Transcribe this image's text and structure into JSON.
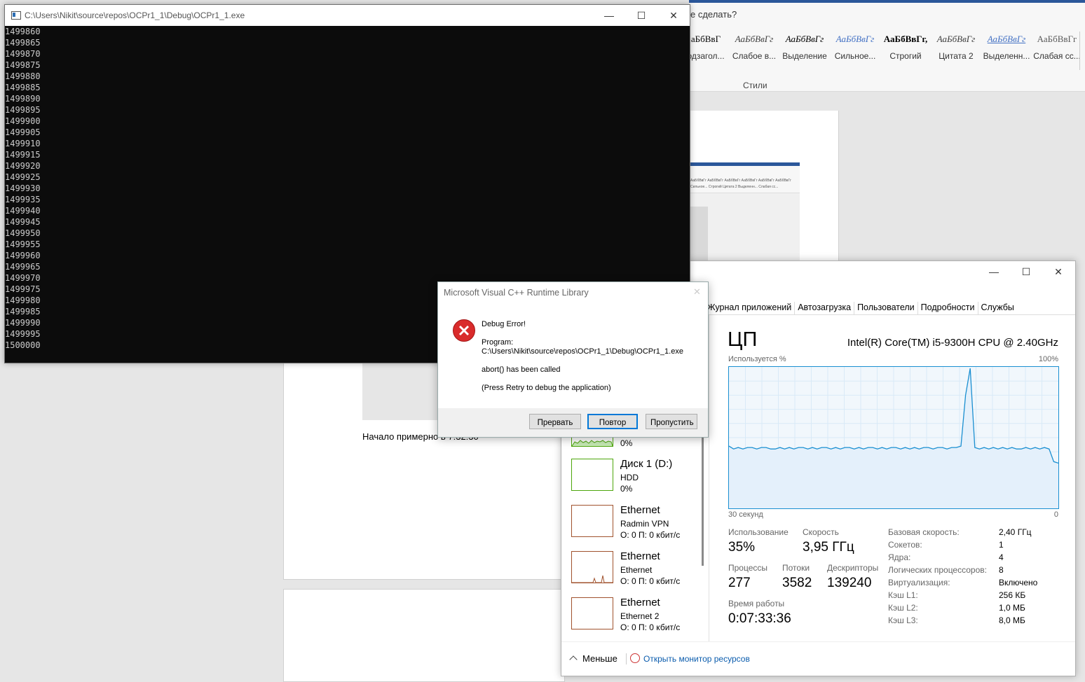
{
  "word": {
    "tell_me": "е сделать?",
    "styles": [
      {
        "sample": "аБбВвГ",
        "name": "одзагол..."
      },
      {
        "sample": "АаБбВвГг",
        "name": "Слабое в..."
      },
      {
        "sample": "АаБбВвГг",
        "name": "Выделение"
      },
      {
        "sample": "АаБбВвГг",
        "name": "Сильное..."
      },
      {
        "sample": "АаБбВвГг,",
        "name": "Строгий"
      },
      {
        "sample": "АаБбВвГг",
        "name": "Цитата 2"
      },
      {
        "sample": "АаБбВвГг",
        "name": "Выделенн..."
      },
      {
        "sample": "АаБбВвГг",
        "name": "Слабая сс..."
      }
    ],
    "styles_group_label": "Стили",
    "thumb_styles": "АаБбВвГг АаБбВвГг АаБбВвГг АаБбВвГг АаБбВвГг АаБбВвГг",
    "thumb_names": "Сильное... Строгий Цитата 2 Выделенн... Слабая сс...",
    "caption": "Начало примерно в 7:32:30"
  },
  "console": {
    "title": "C:\\Users\\Nikit\\source\\repos\\OCPr1_1\\Debug\\OCPr1_1.exe",
    "lines": [
      "1499860",
      "1499865",
      "1499870",
      "1499875",
      "1499880",
      "1499885",
      "1499890",
      "1499895",
      "1499900",
      "1499905",
      "1499910",
      "1499915",
      "1499920",
      "1499925",
      "1499930",
      "1499935",
      "1499940",
      "1499945",
      "1499950",
      "1499955",
      "1499960",
      "1499965",
      "1499970",
      "1499975",
      "1499980",
      "1499985",
      "1499990",
      "1499995",
      "1500000"
    ]
  },
  "window_buttons": {
    "minimize": "—",
    "maximize": "☐",
    "close": "✕"
  },
  "dialog": {
    "title": "Microsoft Visual C++ Runtime Library",
    "heading": "Debug Error!",
    "program_label": "Program:",
    "program_path": "C:\\Users\\Nikit\\source\\repos\\OCPr1_1\\Debug\\OCPr1_1.exe",
    "message": "abort() has been called",
    "hint": "(Press Retry to debug the application)",
    "buttons": {
      "abort": "Прервать",
      "retry": "Повтор",
      "ignore": "Пропустить"
    },
    "close_glyph": "✕"
  },
  "taskmgr": {
    "tabs": [
      "Журнал приложений",
      "Автозагрузка",
      "Пользователи",
      "Подробности",
      "Службы"
    ],
    "left_items": [
      {
        "title": "",
        "sub": "",
        "value": "0%"
      },
      {
        "title": "Диск 1 (D:)",
        "sub": "HDD",
        "value": "0%"
      },
      {
        "title": "Ethernet",
        "sub": "Radmin VPN",
        "value": "О: 0 П: 0 кбит/с"
      },
      {
        "title": "Ethernet",
        "sub": "Ethernet",
        "value": "О: 0 П: 0 кбит/с"
      },
      {
        "title": "Ethernet",
        "sub": "Ethernet 2",
        "value": "О: 0 П: 0 кбит/с"
      }
    ],
    "cpu_title": "ЦП",
    "cpu_name": "Intel(R) Core(TM) i5-9300H CPU @ 2.40GHz",
    "graph_top_left": "Используется %",
    "graph_top_right": "100%",
    "graph_bottom_left": "30 секунд",
    "graph_bottom_right": "0",
    "graph_values": [
      44,
      42,
      43,
      42,
      43,
      43,
      42,
      43,
      43,
      42,
      42,
      43,
      42,
      43,
      42,
      43,
      43,
      42,
      43,
      42,
      43,
      43,
      42,
      43,
      42,
      43,
      43,
      42,
      43,
      42,
      43,
      43,
      42,
      43,
      42,
      43,
      43,
      42,
      43,
      42,
      43,
      42,
      43,
      43,
      42,
      43,
      43,
      42,
      43,
      43,
      44,
      80,
      99,
      43,
      42,
      43,
      42,
      43,
      42,
      43,
      42,
      43,
      42,
      42,
      43,
      42,
      43,
      42,
      43,
      42,
      33,
      32
    ],
    "stats": {
      "usage_label": "Использование",
      "usage": "35%",
      "speed_label": "Скорость",
      "speed": "3,95 ГГц",
      "processes_label": "Процессы",
      "processes": "277",
      "threads_label": "Потоки",
      "threads": "3582",
      "handles_label": "Дескрипторы",
      "handles": "139240",
      "uptime_label": "Время работы",
      "uptime": "0:07:33:36"
    },
    "specs": [
      {
        "label": "Базовая скорость:",
        "value": "2,40 ГГц"
      },
      {
        "label": "Сокетов:",
        "value": "1"
      },
      {
        "label": "Ядра:",
        "value": "4"
      },
      {
        "label": "Логических процессоров:",
        "value": "8"
      },
      {
        "label": "Виртуализация:",
        "value": "Включено"
      },
      {
        "label": "Кэш L1:",
        "value": "256 КБ"
      },
      {
        "label": "Кэш L2:",
        "value": "1,0 МБ"
      },
      {
        "label": "Кэш L3:",
        "value": "8,0 МБ"
      }
    ],
    "footer_less": "Меньше",
    "footer_monitor": "Открыть монитор ресурсов"
  }
}
